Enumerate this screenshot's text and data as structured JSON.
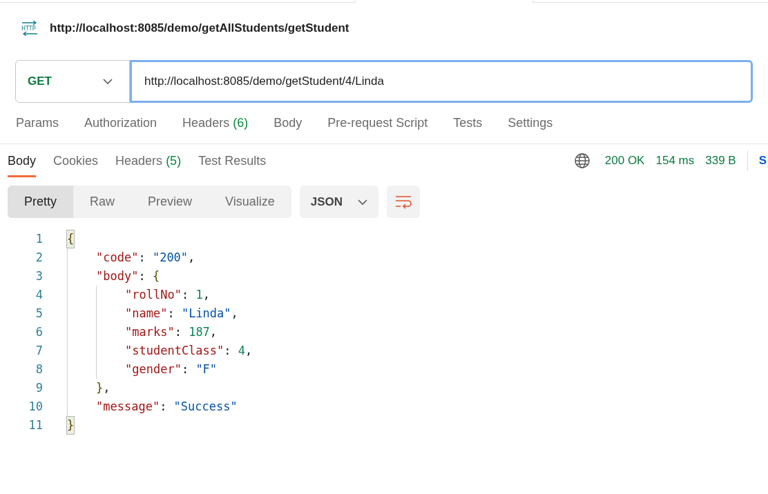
{
  "request": {
    "title": "http://localhost:8085/demo/getAllStudents/getStudent",
    "icon_text": "HTTP",
    "method": "GET",
    "url": "http://localhost:8085/demo/getStudent/4/Linda"
  },
  "request_tabs": [
    {
      "label": "Params",
      "selected": false
    },
    {
      "label": "Authorization",
      "selected": false
    },
    {
      "label": "Headers",
      "count": "(6)",
      "selected": false
    },
    {
      "label": "Body",
      "selected": false
    },
    {
      "label": "Pre-request Script",
      "selected": false
    },
    {
      "label": "Tests",
      "selected": false
    },
    {
      "label": "Settings",
      "selected": false
    }
  ],
  "response_tabs": [
    {
      "label": "Body",
      "selected": true
    },
    {
      "label": "Cookies",
      "selected": false
    },
    {
      "label": "Headers",
      "count": "(5)",
      "selected": false
    },
    {
      "label": "Test Results",
      "selected": false
    }
  ],
  "response_meta": {
    "status": "200 OK",
    "time": "154 ms",
    "size": "339 B",
    "action": "S"
  },
  "view_modes": [
    {
      "label": "Pretty",
      "selected": true
    },
    {
      "label": "Raw",
      "selected": false
    },
    {
      "label": "Preview",
      "selected": false
    },
    {
      "label": "Visualize",
      "selected": false
    }
  ],
  "format": "JSON",
  "code": {
    "lines": [
      {
        "number": "1",
        "tokens": [
          {
            "kind": "bracket",
            "text": "{",
            "matched": true
          }
        ],
        "children": [
          {
            "number": "2",
            "tokens": [
              {
                "kind": "key",
                "text": "\"code\""
              },
              {
                "kind": "punct",
                "text": ": "
              },
              {
                "kind": "string",
                "text": "\"200\""
              },
              {
                "kind": "punct",
                "text": ","
              }
            ]
          },
          {
            "number": "3",
            "tokens": [
              {
                "kind": "key",
                "text": "\"body\""
              },
              {
                "kind": "punct",
                "text": ": "
              },
              {
                "kind": "bracket",
                "text": "{",
                "matched": false
              }
            ],
            "children": [
              {
                "number": "4",
                "tokens": [
                  {
                    "kind": "key",
                    "text": "\"rollNo\""
                  },
                  {
                    "kind": "punct",
                    "text": ": "
                  },
                  {
                    "kind": "number",
                    "text": "1"
                  },
                  {
                    "kind": "punct",
                    "text": ","
                  }
                ]
              },
              {
                "number": "5",
                "tokens": [
                  {
                    "kind": "key",
                    "text": "\"name\""
                  },
                  {
                    "kind": "punct",
                    "text": ": "
                  },
                  {
                    "kind": "string",
                    "text": "\"Linda\""
                  },
                  {
                    "kind": "punct",
                    "text": ","
                  }
                ]
              },
              {
                "number": "6",
                "tokens": [
                  {
                    "kind": "key",
                    "text": "\"marks\""
                  },
                  {
                    "kind": "punct",
                    "text": ": "
                  },
                  {
                    "kind": "number",
                    "text": "187"
                  },
                  {
                    "kind": "punct",
                    "text": ","
                  }
                ]
              },
              {
                "number": "7",
                "tokens": [
                  {
                    "kind": "key",
                    "text": "\"studentClass\""
                  },
                  {
                    "kind": "punct",
                    "text": ": "
                  },
                  {
                    "kind": "number",
                    "text": "4"
                  },
                  {
                    "kind": "punct",
                    "text": ","
                  }
                ]
              },
              {
                "number": "8",
                "tokens": [
                  {
                    "kind": "key",
                    "text": "\"gender\""
                  },
                  {
                    "kind": "punct",
                    "text": ": "
                  },
                  {
                    "kind": "string",
                    "text": "\"F\""
                  }
                ]
              }
            ]
          },
          {
            "number": "9",
            "tokens": [
              {
                "kind": "bracket",
                "text": "}",
                "matched": false
              },
              {
                "kind": "punct",
                "text": ","
              }
            ]
          },
          {
            "number": "10",
            "tokens": [
              {
                "kind": "key",
                "text": "\"message\""
              },
              {
                "kind": "punct",
                "text": ": "
              },
              {
                "kind": "string",
                "text": "\"Success\""
              }
            ]
          }
        ]
      },
      {
        "number": "11",
        "tokens": [
          {
            "kind": "bracket",
            "text": "}",
            "matched": true
          }
        ]
      }
    ]
  }
}
